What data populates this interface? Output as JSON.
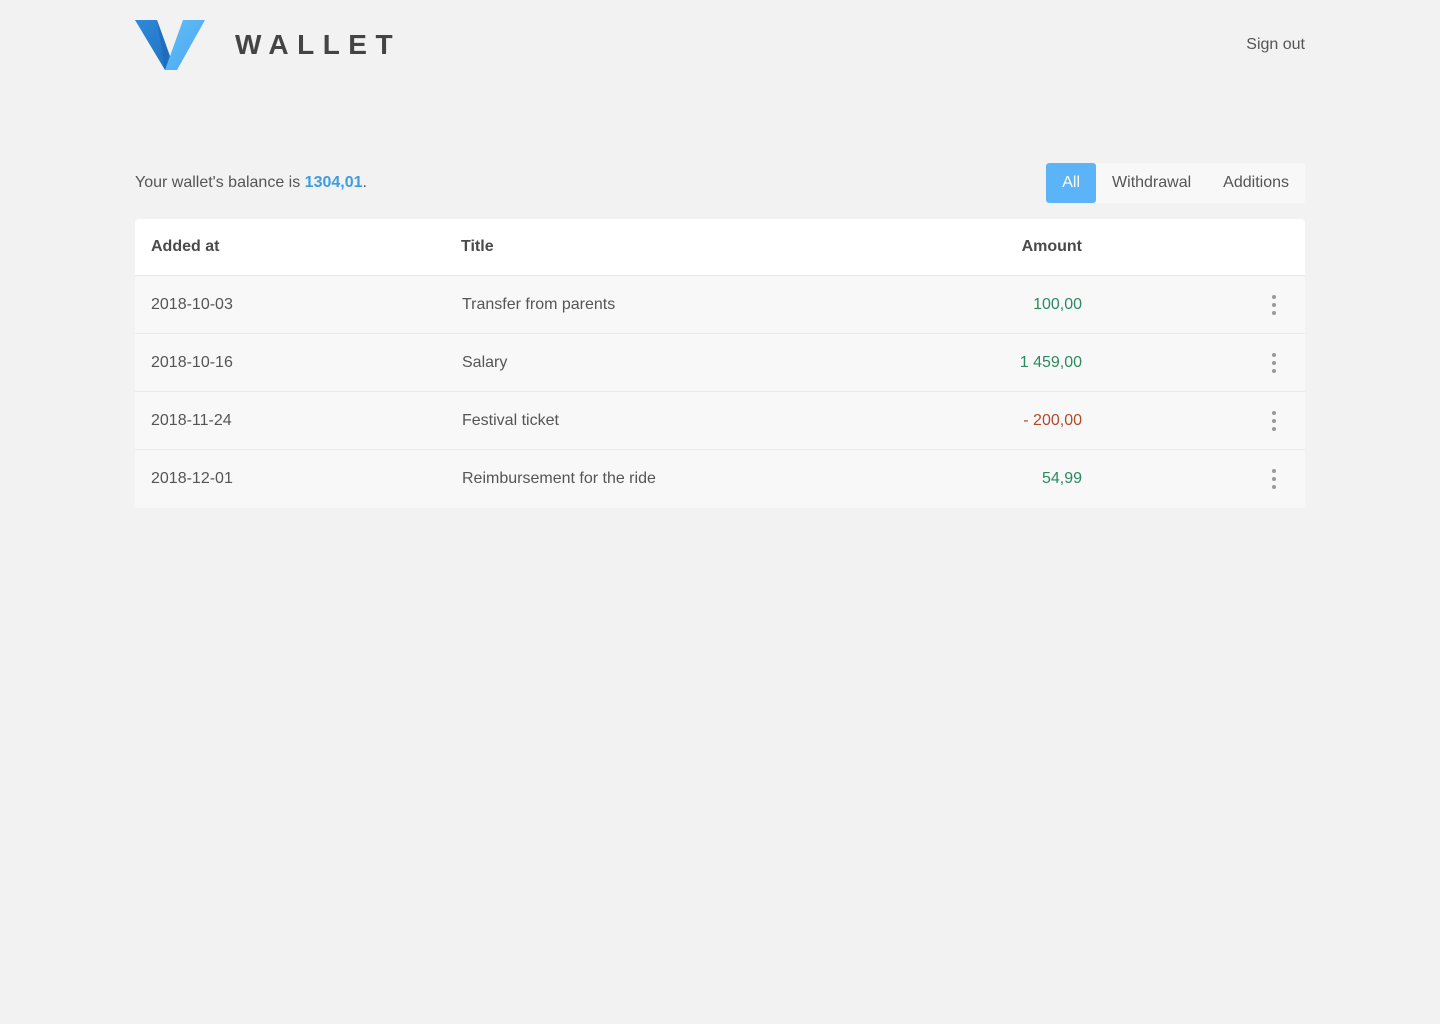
{
  "app": {
    "brand_name": "WALLET",
    "sign_out_label": "Sign out",
    "logo_icon": "wallet-v-logo",
    "colors": {
      "accent": "#5ab4f7",
      "balance": "#3d9de0",
      "positive": "#2b8a5e",
      "negative": "#b24a2a",
      "background": "#f2f2f2"
    }
  },
  "balance": {
    "prefix": "Your wallet's balance is ",
    "amount": "1304,01",
    "suffix": "."
  },
  "filters": {
    "items": [
      {
        "label": "All",
        "active": true
      },
      {
        "label": "Withdrawal",
        "active": false
      },
      {
        "label": "Additions",
        "active": false
      }
    ]
  },
  "table": {
    "headers": {
      "added_at": "Added at",
      "title": "Title",
      "amount": "Amount"
    },
    "rows": [
      {
        "date": "2018-10-03",
        "title": "Transfer from parents",
        "amount": "100,00",
        "type": "positive"
      },
      {
        "date": "2018-10-16",
        "title": "Salary",
        "amount": "1 459,00",
        "type": "positive"
      },
      {
        "date": "2018-11-24",
        "title": "Festival ticket",
        "amount": "- 200,00",
        "type": "negative"
      },
      {
        "date": "2018-12-01",
        "title": "Reimbursement for the ride",
        "amount": "54,99",
        "type": "positive"
      }
    ],
    "row_menu_icon": "more-vertical-icon"
  }
}
